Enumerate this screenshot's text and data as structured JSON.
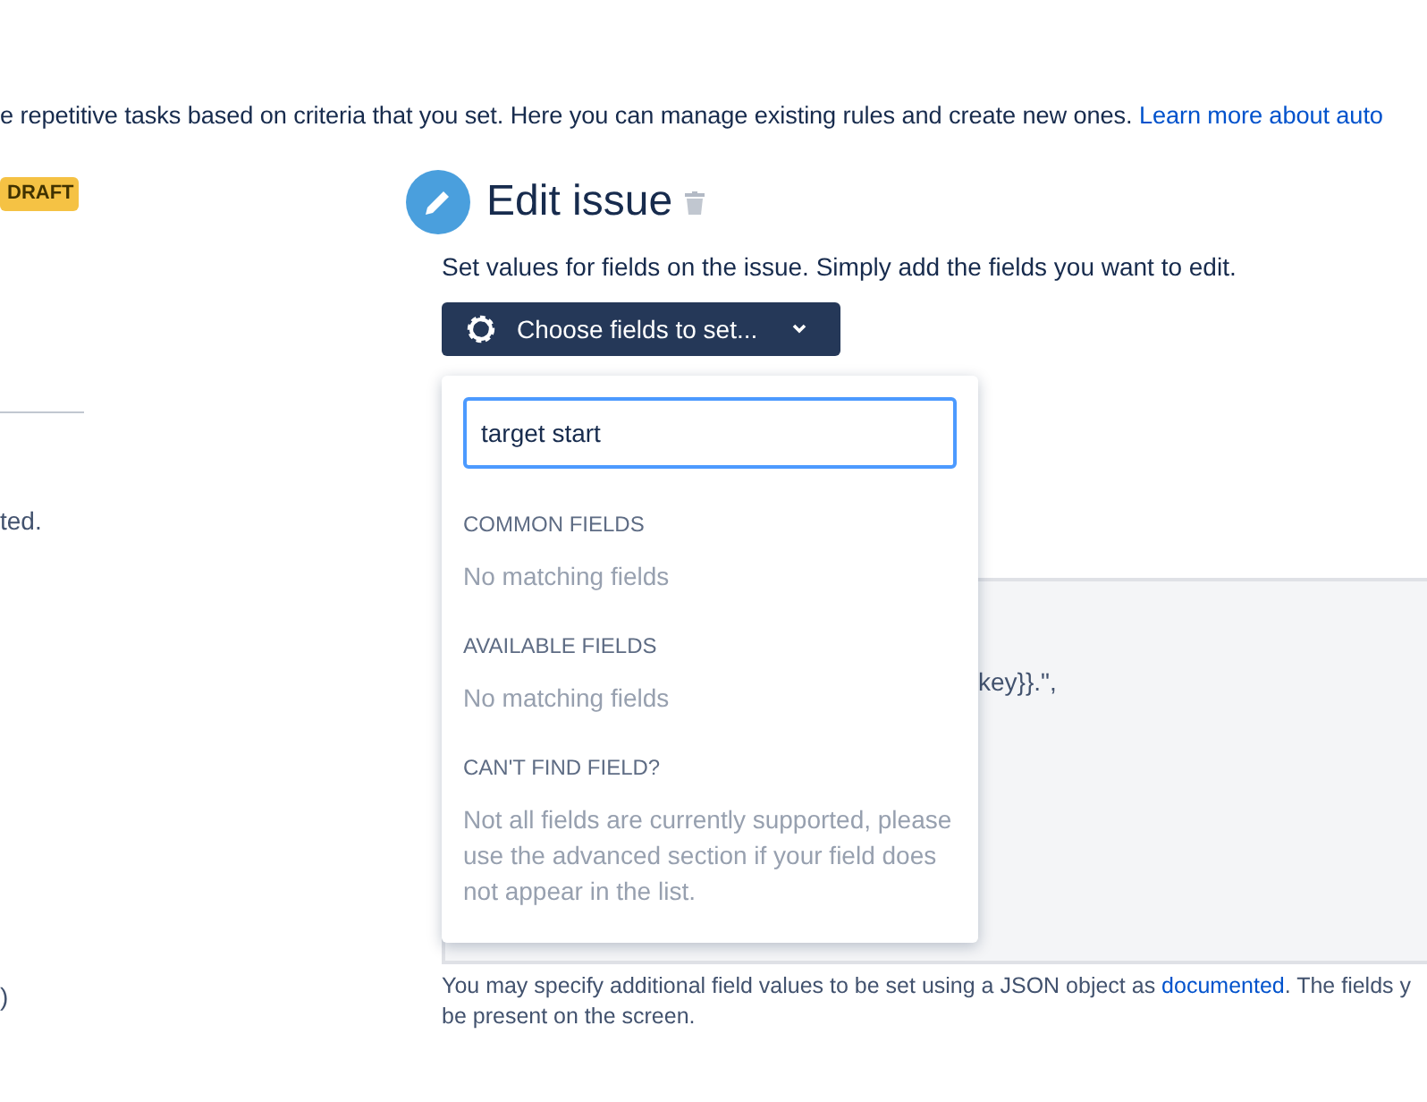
{
  "intro": {
    "text": "e repetitive tasks based on criteria that you set. Here you can manage existing rules and create new ones. ",
    "link": "Learn more about auto"
  },
  "sidebar": {
    "badge": "DRAFT",
    "texts": [
      "ted.",
      ")"
    ]
  },
  "action": {
    "title": "Edit issue",
    "description": "Set values for fields on the issue. Simply add the fields you want to edit.",
    "button": "Choose fields to set...",
    "dropdown": {
      "search_value": "target start",
      "sections": [
        {
          "heading": "COMMON FIELDS",
          "message": "No matching fields"
        },
        {
          "heading": "AVAILABLE FIELDS",
          "message": "No matching fields"
        },
        {
          "heading": "CAN'T FIND FIELD?",
          "message": "Not all fields are currently supported, please use the advanced section if your field does not appear in the list."
        }
      ]
    },
    "advanced_text": "key}}.\",",
    "hint": {
      "before": "You may specify additional field values to be set using a JSON object as ",
      "link": "documented",
      "after": ". The fields y",
      "line2": "be present on the screen."
    }
  }
}
